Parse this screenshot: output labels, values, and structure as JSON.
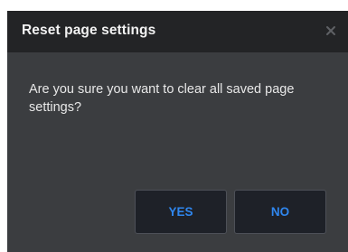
{
  "dialog": {
    "title": "Reset page settings",
    "close_icon": "close-icon",
    "message": "Are you sure you want to clear all saved page settings?",
    "buttons": {
      "yes_label": "YES",
      "no_label": "NO"
    }
  },
  "colors": {
    "title_bar": "#232426",
    "body": "#3b3d40",
    "button_bg": "#1e2128",
    "button_text": "#2f86ee"
  }
}
